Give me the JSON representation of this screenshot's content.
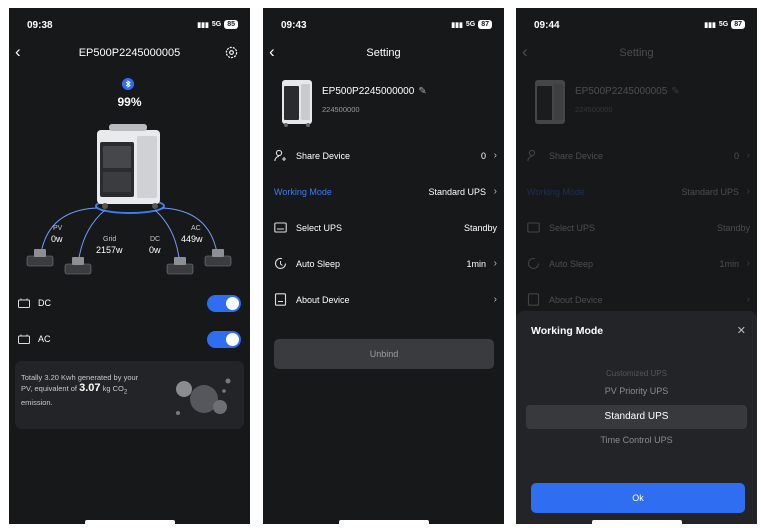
{
  "colors": {
    "accent": "#2f6ef1",
    "background": "#17181a",
    "card": "#232427"
  },
  "screen1": {
    "status": {
      "time": "09:38",
      "network": "5G",
      "battery": "85"
    },
    "nav": {
      "title": "EP500P2245000005",
      "back_icon": "chevron-left-icon",
      "settings_icon": "gear-icon"
    },
    "bluetooth_icon": "bluetooth-icon",
    "battery_percent": "99%",
    "flows": {
      "pv": {
        "label": "PV",
        "value": "0w"
      },
      "grid": {
        "label": "Grid",
        "value": "2157w"
      },
      "dc": {
        "label": "DC",
        "value": "0w"
      },
      "ac": {
        "label": "AC",
        "value": "449w"
      }
    },
    "ports": [
      {
        "label": "DC",
        "enabled": true
      },
      {
        "label": "AC",
        "enabled": true
      }
    ],
    "eco": {
      "line1": "Totally 3.20 Kwh generated by your",
      "line2_pre": "PV, equivalent of ",
      "amount": "3.07",
      "line2_post": " kg CO",
      "sub": "2",
      "line3": "emission."
    }
  },
  "screen2": {
    "status": {
      "time": "09:43",
      "network": "5G",
      "battery": "87"
    },
    "nav": {
      "title": "Setting"
    },
    "device": {
      "name": "EP500P2245000000",
      "serial": "224500000"
    },
    "menu": [
      {
        "label": "Share Device",
        "value": "0",
        "icon": "share-user-icon",
        "chevron": true
      },
      {
        "label": "Working Mode",
        "value": "Standard UPS",
        "icon": "",
        "chevron": true
      },
      {
        "label": "Select UPS",
        "value": "Standby",
        "icon": "ups-icon",
        "chevron": false
      },
      {
        "label": "Auto Sleep",
        "value": "1min",
        "icon": "sleep-timer-icon",
        "chevron": true
      },
      {
        "label": "About Device",
        "value": "",
        "icon": "about-device-icon",
        "chevron": true
      }
    ],
    "unbind_label": "Unbind"
  },
  "screen3": {
    "status": {
      "time": "09:44",
      "network": "5G",
      "battery": "87"
    },
    "nav": {
      "title": "Setting"
    },
    "device": {
      "name": "EP500P2245000005",
      "serial": "224500000"
    },
    "menu": [
      {
        "label": "Share Device",
        "value": "0"
      },
      {
        "label": "Working Mode",
        "value": "Standard UPS"
      },
      {
        "label": "Select UPS",
        "value": "Standby"
      },
      {
        "label": "Auto Sleep",
        "value": "1min"
      },
      {
        "label": "About Device",
        "value": ""
      }
    ],
    "sheet": {
      "title": "Working Mode",
      "options": [
        "Customized UPS",
        "PV Priority UPS",
        "Standard UPS",
        "Time Control UPS"
      ],
      "selected": "Standard UPS",
      "ok_label": "Ok"
    }
  }
}
